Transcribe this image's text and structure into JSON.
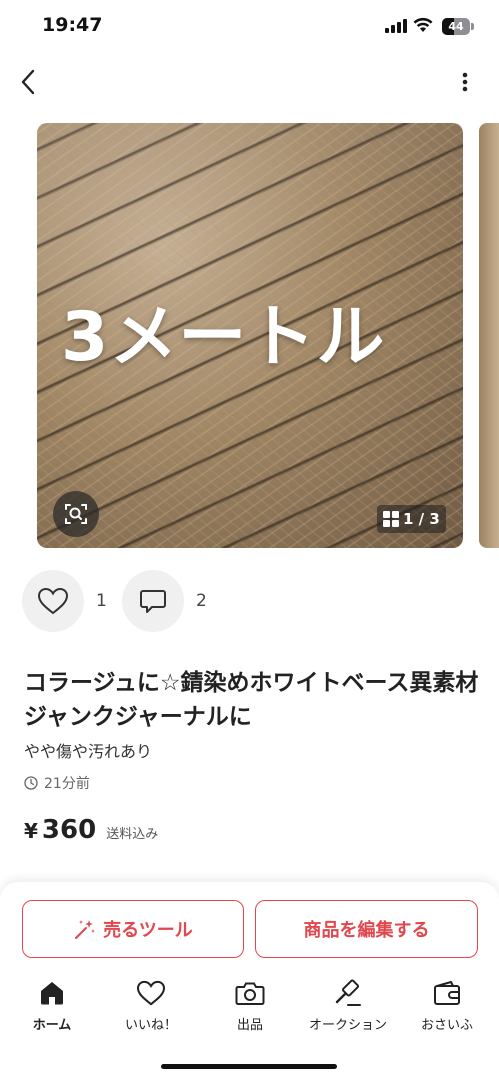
{
  "status_bar": {
    "time": "19:47",
    "battery": "44"
  },
  "carousel": {
    "overlay_text": "3メートル",
    "page_indicator": "1 / 3"
  },
  "actions": {
    "like_count": "1",
    "comment_count": "2"
  },
  "item": {
    "title": "コラージュに☆錆染めホワイトベース異素材ジャンクジャーナルに",
    "condition": "やや傷や汚れあり",
    "posted": "21分前",
    "price_currency": "¥",
    "price": "360",
    "shipping": "送料込み"
  },
  "buttons": {
    "sell_tool": "売るツール",
    "edit_item": "商品を編集する"
  },
  "tabs": [
    {
      "label": "ホーム",
      "icon": "home-icon"
    },
    {
      "label": "いいね！",
      "icon": "heart-icon"
    },
    {
      "label": "出品",
      "icon": "camera-icon"
    },
    {
      "label": "オークション",
      "icon": "gavel-icon"
    },
    {
      "label": "おさいふ",
      "icon": "wallet-icon"
    }
  ],
  "colors": {
    "accent": "#e2474d",
    "text": "#222222",
    "muted": "#666666"
  }
}
